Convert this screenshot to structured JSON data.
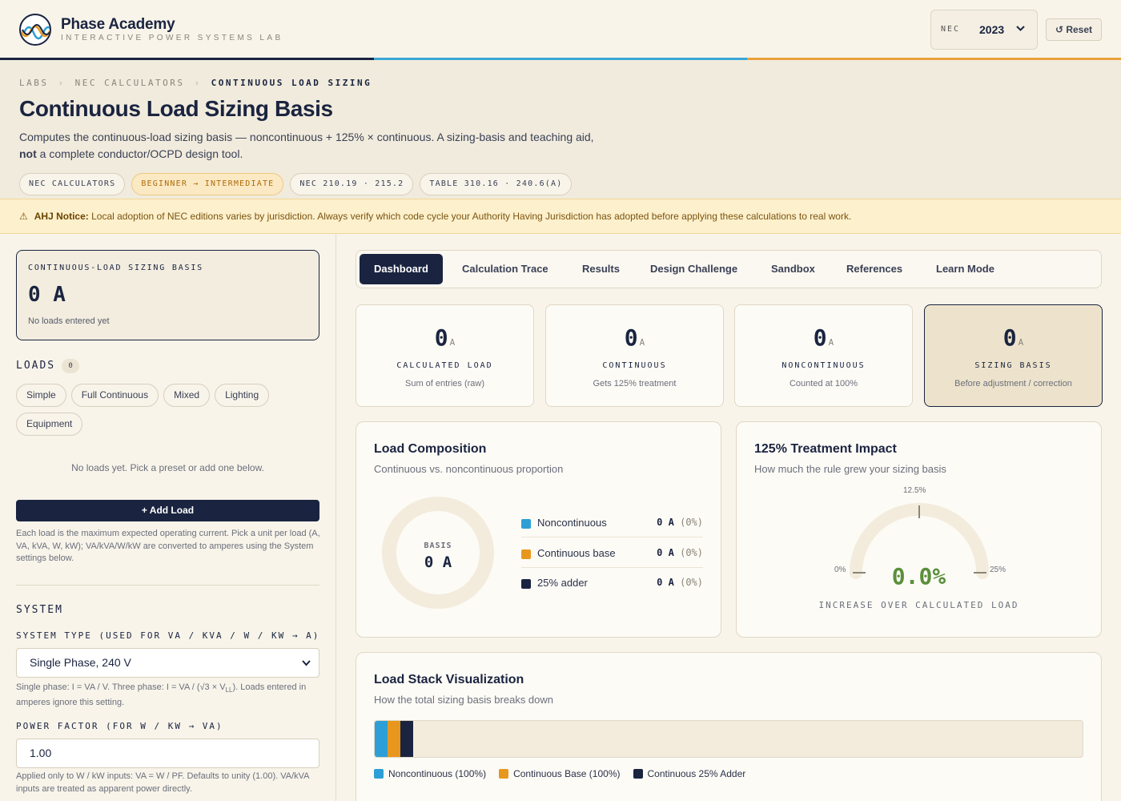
{
  "header": {
    "brand_name": "Phase Academy",
    "brand_sub": "INTERACTIVE POWER SYSTEMS LAB",
    "nec_label": "NEC",
    "nec_value": "2023",
    "reset_label": "↺ Reset",
    "stripe_colors": [
      "#1a2440",
      "#3aa6d8",
      "#e8a23a"
    ]
  },
  "hero": {
    "breadcrumbs": [
      "LABS",
      "NEC CALCULATORS",
      "CONTINUOUS LOAD SIZING"
    ],
    "title": "Continuous Load Sizing Basis",
    "desc_line1": "Computes the continuous-load sizing basis — noncontinuous + 125% × continuous. A sizing-basis and teaching aid,",
    "desc_bold": "not",
    "desc_line2": " a complete conductor/OCPD design tool.",
    "tags": [
      "NEC CALCULATORS",
      "BEGINNER → INTERMEDIATE",
      "NEC 210.19 · 215.2",
      "TABLE 310.16 · 240.6(A)"
    ]
  },
  "notice": {
    "icon": "warning-icon",
    "bold": "AHJ Notice:",
    "text": " Local adoption of NEC editions varies by jurisdiction. Always verify which code cycle your Authority Having Jurisdiction has adopted before applying these calculations to real work."
  },
  "left": {
    "basis_label": "CONTINUOUS-LOAD SIZING BASIS",
    "basis_value": "0 A",
    "basis_note": "No loads entered yet",
    "loads_heading": "LOADS",
    "loads_count": "0",
    "presets": [
      "Simple",
      "Full Continuous",
      "Mixed",
      "Lighting",
      "Equipment"
    ],
    "empty_msg": "No loads yet. Pick a preset or add one below.",
    "add_label": "+ Add Load",
    "add_help": "Each load is the maximum expected operating current. Pick a unit per load (A, VA, kVA, W, kW); VA/kVA/W/kW are converted to amperes using the System settings below.",
    "system_heading": "SYSTEM",
    "system_type_label": "SYSTEM TYPE (USED FOR VA / KVA / W / KW → A)",
    "system_type_value": "Single Phase, 240 V",
    "system_help_a": "Single phase: I = VA / V. Three phase: I = VA / (√3 × V",
    "system_help_sub": "LL",
    "system_help_b": "). Loads entered in amperes ignore this setting.",
    "pf_label": "POWER FACTOR (FOR W / KW → VA)",
    "pf_value": "1.00",
    "pf_help": "Applied only to W / kW inputs: VA = W / PF. Defaults to unity (1.00). VA/kVA inputs are treated as apparent power directly."
  },
  "tabs": [
    "Dashboard",
    "Calculation Trace",
    "Results",
    "Design Challenge",
    "Sandbox",
    "References",
    "Learn Mode"
  ],
  "active_tab": "Dashboard",
  "stats": [
    {
      "value": "0",
      "unit": "A",
      "label": "CALCULATED LOAD",
      "sub": "Sum of entries (raw)"
    },
    {
      "value": "0",
      "unit": "A",
      "label": "CONTINUOUS",
      "sub": "Gets 125% treatment"
    },
    {
      "value": "0",
      "unit": "A",
      "label": "NONCONTINUOUS",
      "sub": "Counted at 100%"
    },
    {
      "value": "0",
      "unit": "A",
      "label": "SIZING BASIS",
      "sub": "Before adjustment / correction"
    }
  ],
  "composition": {
    "title": "Load Composition",
    "subtitle": "Continuous vs. noncontinuous proportion",
    "center_label": "BASIS",
    "center_value": "0 A",
    "rows": [
      {
        "name": "Noncontinuous",
        "value": "0 A",
        "pct": "(0%)",
        "color": "#2d9fd6"
      },
      {
        "name": "Continuous base",
        "value": "0 A",
        "pct": "(0%)",
        "color": "#e8971e"
      },
      {
        "name": "25% adder",
        "value": "0 A",
        "pct": "(0%)",
        "color": "#1a2440"
      }
    ]
  },
  "impact": {
    "title": "125% Treatment Impact",
    "subtitle": "How much the rule grew your sizing basis",
    "tick_min": "0%",
    "tick_mid": "12.5%",
    "tick_max": "25%",
    "value": "0.0%",
    "value_fraction": 0,
    "caption": "INCREASE OVER CALCULATED LOAD"
  },
  "stack": {
    "title": "Load Stack Visualization",
    "subtitle": "How the total sizing basis breaks down",
    "legend": [
      {
        "name": "Noncontinuous (100%)",
        "color": "#2d9fd6"
      },
      {
        "name": "Continuous Base (100%)",
        "color": "#e8971e"
      },
      {
        "name": "Continuous 25% Adder",
        "color": "#1a2440"
      }
    ]
  }
}
